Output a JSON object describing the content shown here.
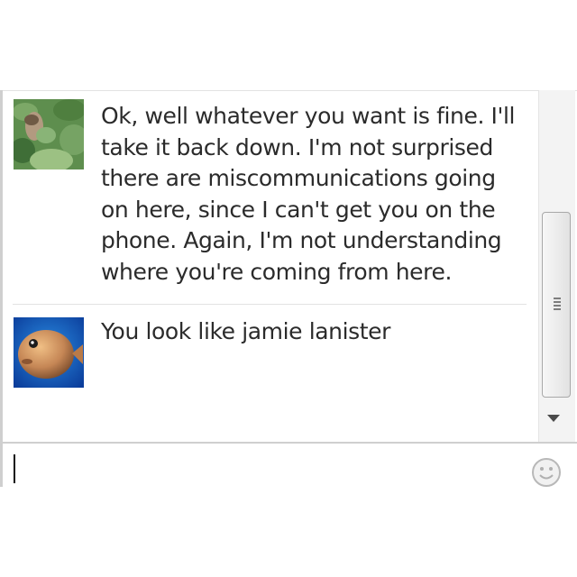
{
  "messages": [
    {
      "avatar": "user-photo-foliage-avatar",
      "text": "Ok, well whatever you want is fine. I'll take it back down. I'm not surprised there are miscommunications going on here, since I can't get you on the phone. Again, I'm not understanding where you're coming from here."
    },
    {
      "avatar": "user-photo-round-fish-avatar",
      "text": "You look like jamie lanister"
    }
  ],
  "input": {
    "value": "",
    "emoji_icon": "smiley-face-icon"
  },
  "colors": {
    "text": "#2b2b2b",
    "divider": "#cfcfcf",
    "scrollbar_thumb": "#e2e2e2"
  }
}
